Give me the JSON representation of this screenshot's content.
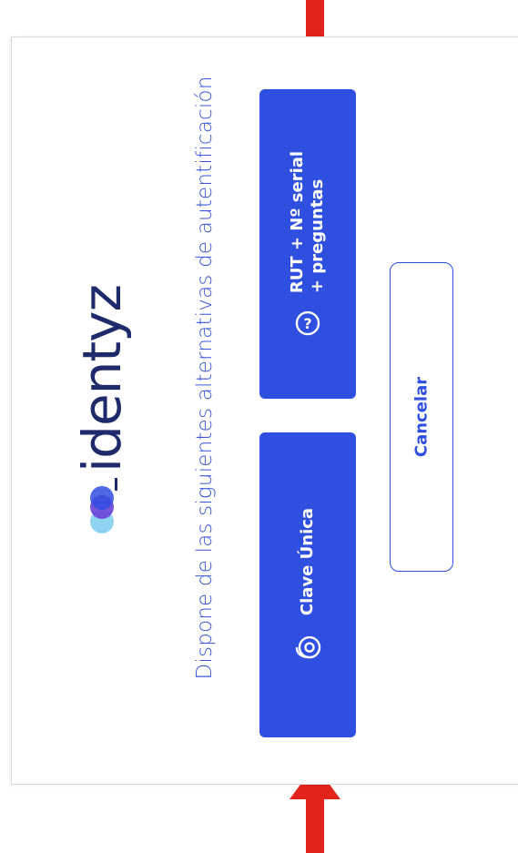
{
  "logo": {
    "text": "identyz"
  },
  "title": "Dispone de las siguientes alternativas de autentificación",
  "buttons": {
    "clave_unica": "Clave Única",
    "rut_line1": "RUT + Nº serial",
    "rut_line2": "+ preguntas",
    "cancel": "Cancelar"
  },
  "colors": {
    "primary": "#2f4fe0",
    "title": "#3b55d8",
    "logo_text": "#1e2a6b",
    "arrow": "#e0231b"
  },
  "icons": {
    "clave_unica": "fingerprint-key-icon",
    "rut": "question-circle-icon",
    "logo_mark": "overlapping-circles-icon",
    "annotation_arrow": "red-arrow-icon"
  }
}
